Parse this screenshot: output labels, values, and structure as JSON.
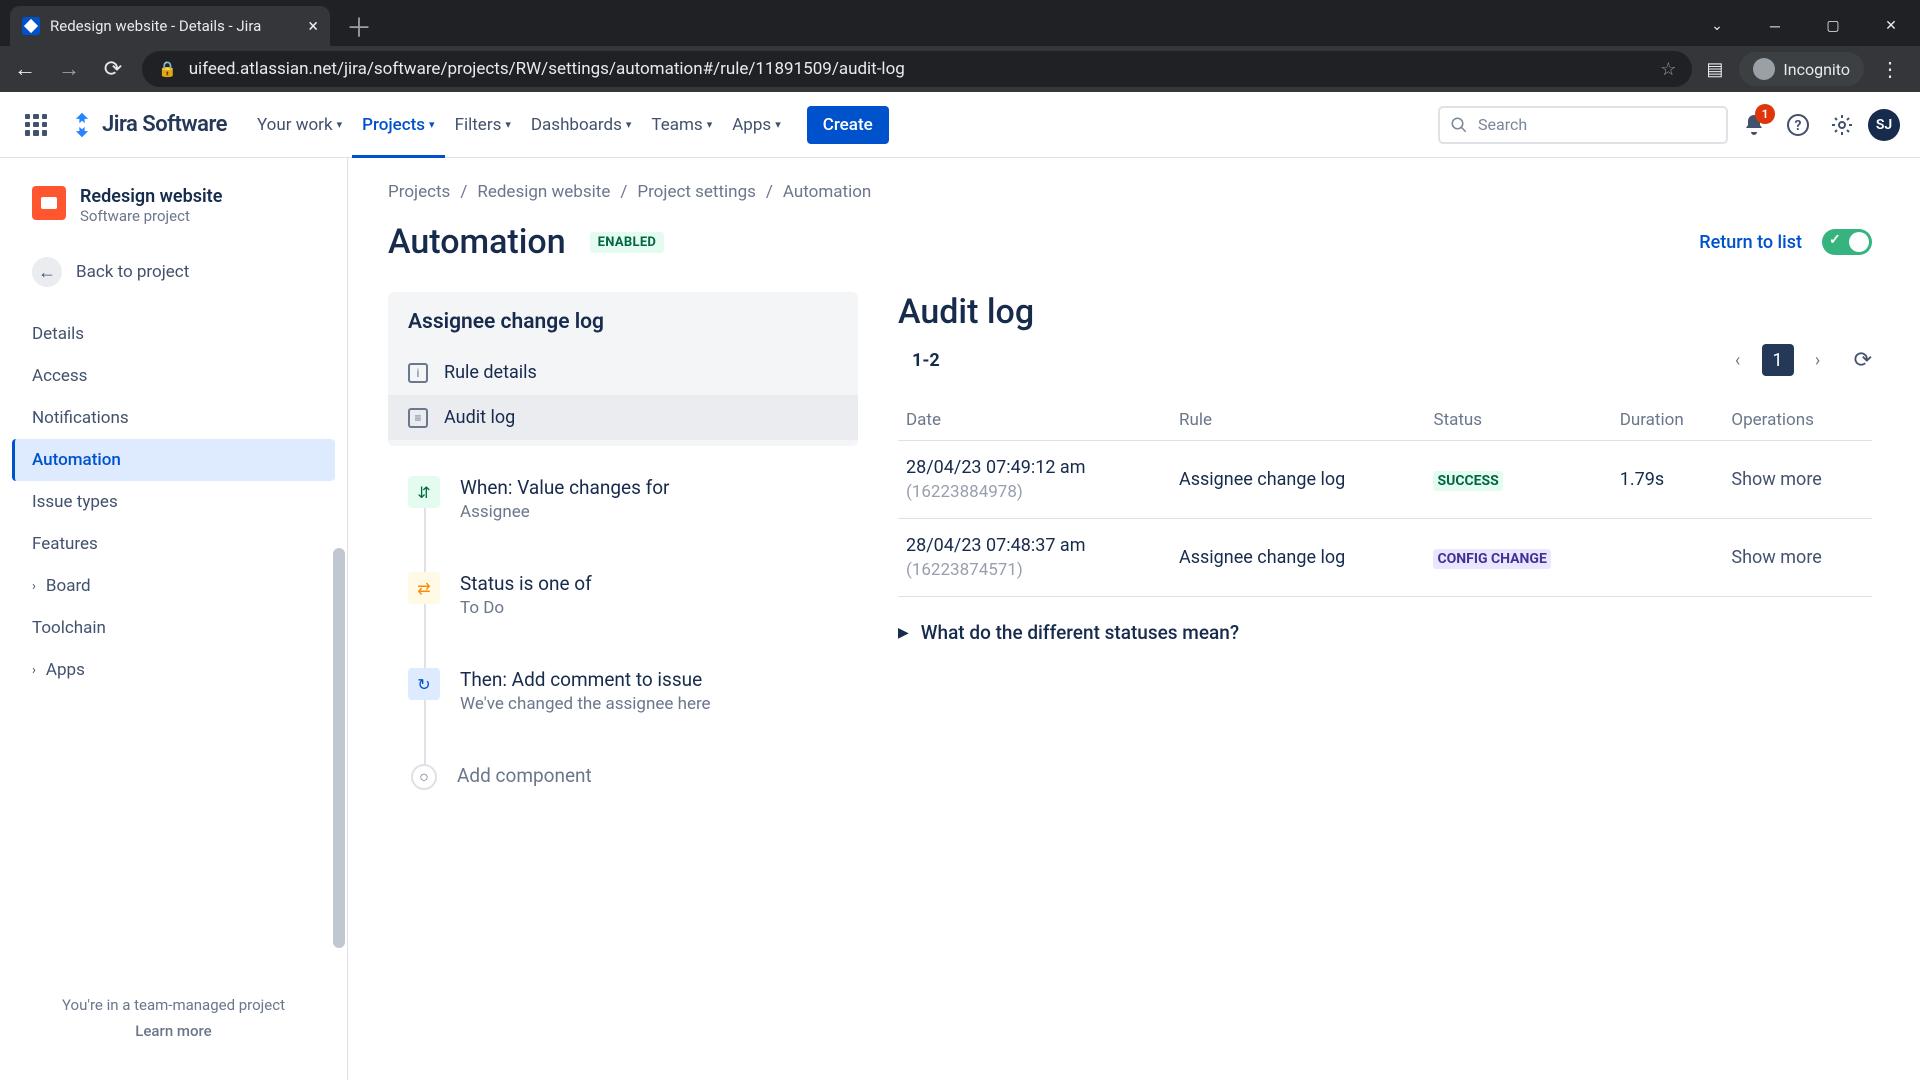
{
  "browser": {
    "tab_title": "Redesign website - Details - Jira",
    "url": "uifeed.atlassian.net/jira/software/projects/RW/settings/automation#/rule/11891509/audit-log",
    "incognito_label": "Incognito"
  },
  "nav": {
    "product": "Jira Software",
    "items": [
      "Your work",
      "Projects",
      "Filters",
      "Dashboards",
      "Teams",
      "Apps"
    ],
    "active_index": 1,
    "create": "Create",
    "search_placeholder": "Search",
    "notif_count": "1",
    "avatar_initials": "SJ"
  },
  "sidebar": {
    "project_name": "Redesign website",
    "project_type": "Software project",
    "back_label": "Back to project",
    "items": [
      "Details",
      "Access",
      "Notifications",
      "Automation",
      "Issue types",
      "Features",
      "Board",
      "Toolchain",
      "Apps"
    ],
    "active_index": 3,
    "expandable": [
      6,
      8
    ],
    "footer": "You're in a team-managed project",
    "learn_more": "Learn more"
  },
  "breadcrumbs": [
    "Projects",
    "Redesign website",
    "Project settings",
    "Automation"
  ],
  "page": {
    "title": "Automation",
    "status": "ENABLED",
    "return": "Return to list"
  },
  "rule": {
    "name": "Assignee change log",
    "nav": [
      {
        "icon": "i",
        "label": "Rule details"
      },
      {
        "icon": "≡",
        "label": "Audit log"
      }
    ],
    "nav_active": 1,
    "steps": [
      {
        "kind": "trigger",
        "icon": "⇵",
        "title": "When: Value changes for",
        "sub": "Assignee"
      },
      {
        "kind": "cond",
        "icon": "⇄",
        "title": "Status is one of",
        "sub": "To Do"
      },
      {
        "kind": "action",
        "icon": "↻",
        "title": "Then: Add comment to issue",
        "sub": "We've changed the assignee here"
      }
    ],
    "add_label": "Add component"
  },
  "audit": {
    "title": "Audit log",
    "range": "1-2",
    "current_page": "1",
    "columns": [
      "Date",
      "Rule",
      "Status",
      "Duration",
      "Operations"
    ],
    "rows": [
      {
        "date": "28/04/23 07:49:12 am",
        "id": "(16223884978)",
        "rule": "Assignee change log",
        "status": "SUCCESS",
        "status_kind": "success",
        "duration": "1.79s",
        "op": "Show more"
      },
      {
        "date": "28/04/23 07:48:37 am",
        "id": "(16223874571)",
        "rule": "Assignee change log",
        "status": "CONFIG CHANGE",
        "status_kind": "config",
        "duration": "",
        "op": "Show more"
      }
    ],
    "help": "What do the different statuses mean?"
  }
}
